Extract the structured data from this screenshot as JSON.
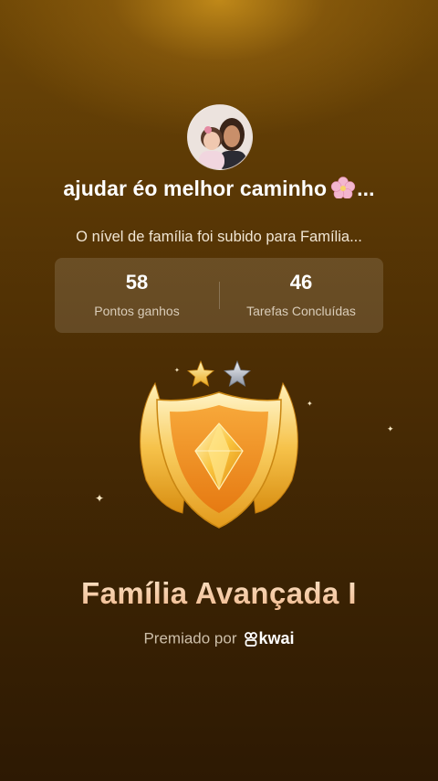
{
  "user": {
    "name": "ajudar éo melhor caminho",
    "name_ellipsis": "...",
    "flower_icon": "cherry-blossom-icon"
  },
  "notice": {
    "level_message": "O nível de família foi subido para Família..."
  },
  "stats": [
    {
      "value": "58",
      "label": "Pontos ganhos"
    },
    {
      "value": "46",
      "label": "Tarefas Concluídas"
    }
  ],
  "badge": {
    "stars_earned": 1,
    "stars_total": 2,
    "level_title": "Família Avançada I"
  },
  "awarded": {
    "prefix": "Premiado por",
    "brand": "kwai"
  },
  "colors": {
    "background_top": "#6e4706",
    "background_bottom": "#2d1903",
    "title_gold": "#f6c9a0",
    "badge_gold": "#f5b52c"
  }
}
